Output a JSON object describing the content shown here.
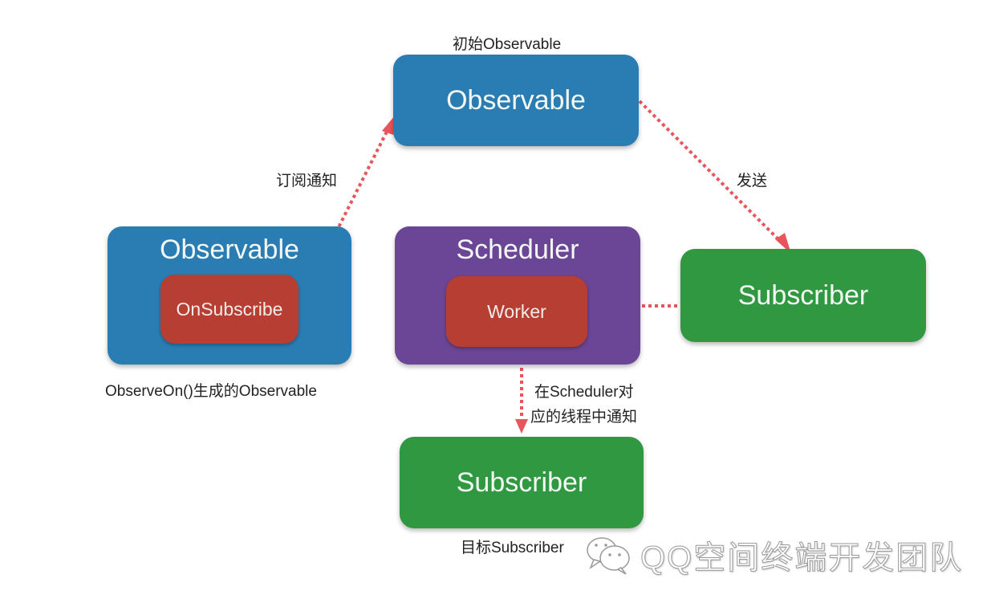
{
  "diagram": {
    "nodes": {
      "source_observable": {
        "title": "Observable",
        "caption": "初始Observable",
        "color": "#2a7db3"
      },
      "observeon_observable": {
        "title": "Observable",
        "inner": "OnSubscribe",
        "caption": "ObserveOn()生成的Observable",
        "color": "#2a7db3",
        "inner_color": "#b63e32"
      },
      "scheduler": {
        "title": "Scheduler",
        "inner": "Worker",
        "color": "#6c4696",
        "inner_color": "#b63e32"
      },
      "subscriber_right": {
        "title": "Subscriber",
        "color": "#2f9840"
      },
      "subscriber_target": {
        "title": "Subscriber",
        "caption": "目标Subscriber",
        "color": "#2f9840"
      }
    },
    "edges": [
      {
        "from": "observeon_observable.OnSubscribe",
        "to": "source_observable",
        "label": "订阅通知"
      },
      {
        "from": "source_observable",
        "to": "subscriber_right",
        "label": "发送"
      },
      {
        "from": "subscriber_right",
        "to": "scheduler.Worker",
        "label": ""
      },
      {
        "from": "scheduler.Worker",
        "to": "subscriber_target",
        "label": "在Scheduler对\n应的线程中通知",
        "label_lines": [
          "在Scheduler对",
          "应的线程中通知"
        ]
      }
    ],
    "arrow_color": "#e8555a"
  },
  "watermark": {
    "icon": "wechat-icon",
    "text": "QQ空间终端开发团队"
  }
}
